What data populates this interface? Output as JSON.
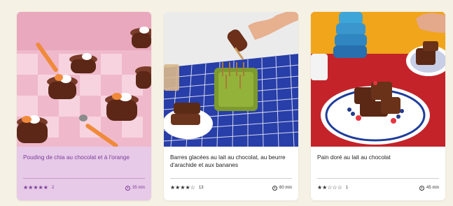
{
  "cards": [
    {
      "title": "Pouding de chia au chocolat et à l'orange",
      "stars": "★★★★★",
      "count": "2",
      "time": "35 min",
      "image": "chocolate-chia-pudding-cups-photo"
    },
    {
      "title": "Barres glacées au lait au chocolat, au beurre d'arachide et aux bananes",
      "stars": "★★★★☆",
      "count": "13",
      "time": "60 min",
      "image": "chocolate-popsicles-photo"
    },
    {
      "title": "Pain doré au lait au chocolat",
      "stars": "★★☆☆☆",
      "count": "1",
      "time": "45 min",
      "image": "chocolate-french-toast-photo"
    }
  ],
  "colors": {
    "page_bg": "#f5f1e4",
    "active_card_bg": "#e7c9e8",
    "active_text": "#7a3d98"
  }
}
